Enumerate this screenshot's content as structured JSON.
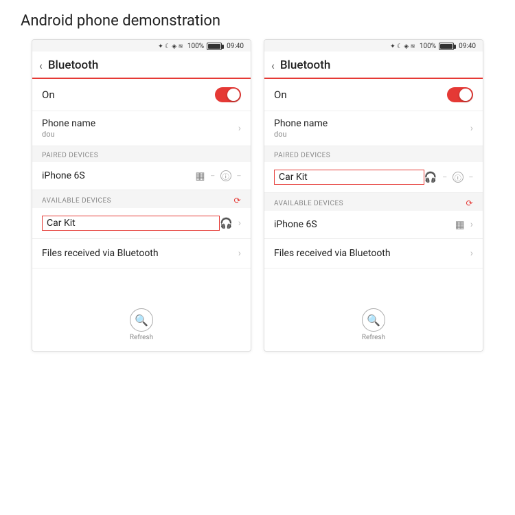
{
  "page": {
    "title": "Android phone demonstration"
  },
  "status_bar": {
    "icons": "✦ ☻ ◈ ≋",
    "battery_percent": "100%",
    "time": "09:40"
  },
  "phone_left": {
    "header": {
      "back": "<",
      "title": "Bluetooth"
    },
    "on_label": "On",
    "phone_name_label": "Phone name",
    "phone_name_value": "dou",
    "paired_section": "PAIRED DEVICES",
    "paired_devices": [
      {
        "name": "iPhone 6S",
        "icon": "phone",
        "info": true,
        "highlight": false
      }
    ],
    "available_section": "AVAILABLE DEVICES",
    "available_devices": [
      {
        "name": "Car Kit",
        "icon": "headphones",
        "highlight": true
      }
    ],
    "files_label": "Files received via Bluetooth",
    "refresh_label": "Refresh"
  },
  "phone_right": {
    "header": {
      "back": "<",
      "title": "Bluetooth"
    },
    "on_label": "On",
    "phone_name_label": "Phone name",
    "phone_name_value": "dou",
    "paired_section": "PAIRED DEVICES",
    "paired_devices": [
      {
        "name": "Car Kit",
        "icon": "headphones",
        "info": true,
        "highlight": true
      }
    ],
    "available_section": "AVAILABLE DEVICES",
    "available_devices": [
      {
        "name": "iPhone 6S",
        "icon": "phone",
        "highlight": false
      }
    ],
    "files_label": "Files received via Bluetooth",
    "refresh_label": "Refresh"
  }
}
